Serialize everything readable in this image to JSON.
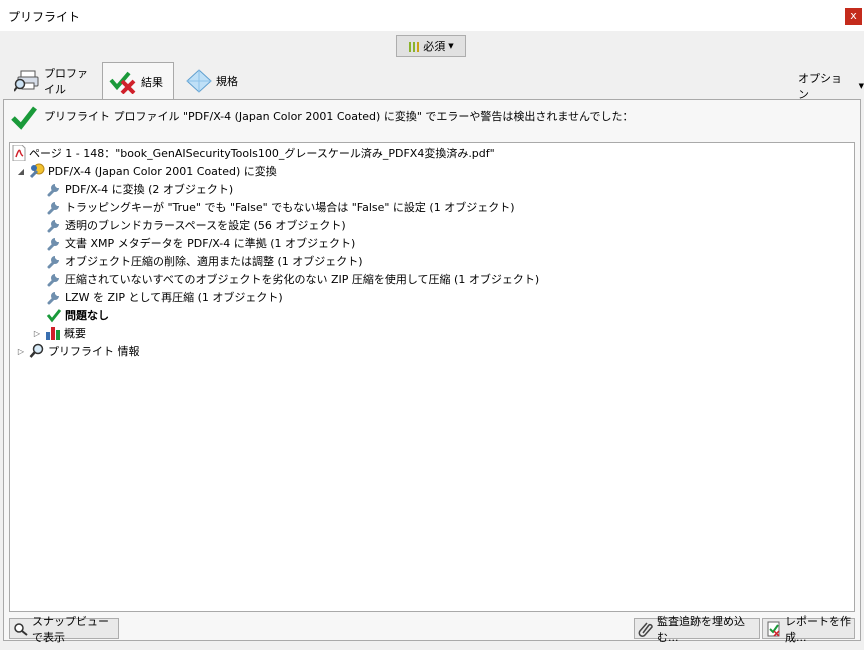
{
  "window": {
    "title": "プリフライト",
    "close_label": "x"
  },
  "mode_dropdown": {
    "label": "必須"
  },
  "tabs": [
    {
      "label": "プロファイル"
    },
    {
      "label": "結果"
    },
    {
      "label": "規格"
    }
  ],
  "options_label": "オプション",
  "summary": "プリフライト プロファイル \"PDF/X-4 (Japan Color 2001 Coated) に変換\" でエラーや警告は検出されませんでした：",
  "tree": {
    "page": "ページ 1 - 148：\"book_GenAISecurityTools100_グレースケール済み_PDFX4変換済み.pdf\"",
    "profile": "PDF/X-4 (Japan Color 2001 Coated) に変換",
    "fixups": [
      "PDF/X-4 に変換 (2 オブジェクト)",
      "トラッピングキーが \"True\" でも \"False\" でもない場合は \"False\" に設定 (1 オブジェクト)",
      "透明のブレンドカラースペースを設定 (56 オブジェクト)",
      "文書 XMP メタデータを PDF/X-4 に準拠 (1 オブジェクト)",
      "オブジェクト圧縮の削除、適用または調整 (1 オブジェクト)",
      "圧縮されていないすべてのオブジェクトを劣化のない ZIP 圧縮を使用して圧縮 (1 オブジェクト)",
      "LZW を ZIP として再圧縮 (1 オブジェクト)"
    ],
    "no_problems": "問題なし",
    "overview": "概要",
    "preflight_info": "プリフライト 情報"
  },
  "buttons": {
    "snap": "スナップビューで表示",
    "embed": "監査追跡を埋め込む...",
    "report": "レポートを作成..."
  },
  "colors": {
    "success": "#1a9a3a",
    "fail": "#d0202a",
    "close": "#c42b1c"
  }
}
